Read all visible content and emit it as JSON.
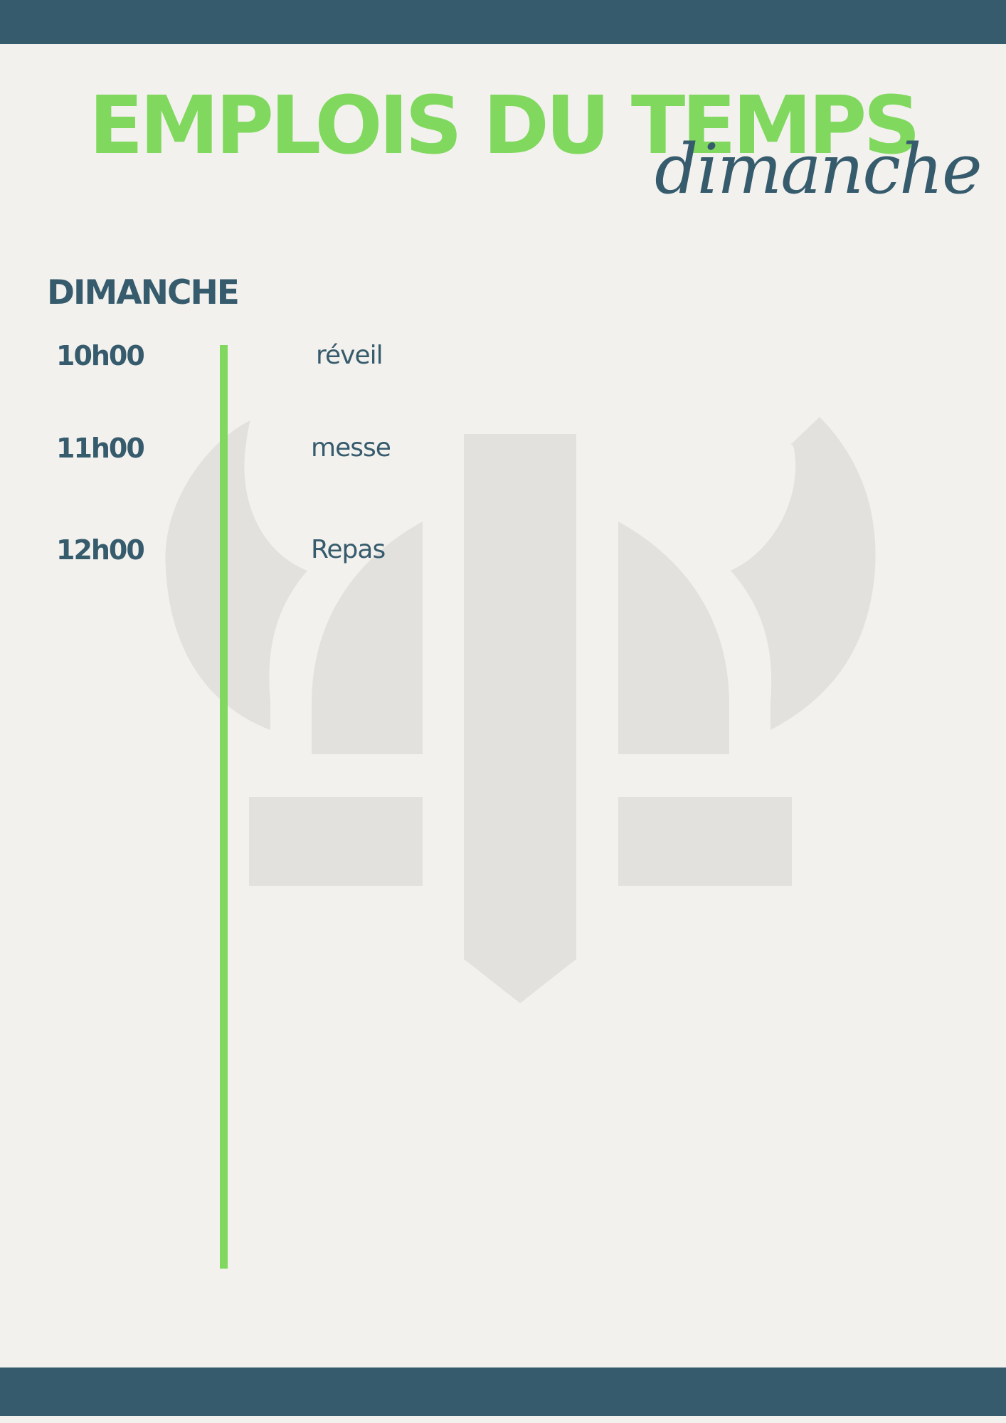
{
  "header": {
    "title": "EMPLOIS DU TEMPS",
    "subtitle_script": "dimanche"
  },
  "schedule": {
    "day": "DIMANCHE",
    "entries": [
      {
        "time": "10h00",
        "activity": "réveil"
      },
      {
        "time": "11h00",
        "activity": "messe"
      },
      {
        "time": "12h00",
        "activity": "Repas"
      }
    ]
  },
  "colors": {
    "band": "#365b6d",
    "accent_green": "#80d95e",
    "text_dark": "#365b6d",
    "background": "#f2f1ed",
    "watermark": "#e2e1de"
  },
  "icons": {
    "watermark": "viking-helmet-sword-logo"
  }
}
